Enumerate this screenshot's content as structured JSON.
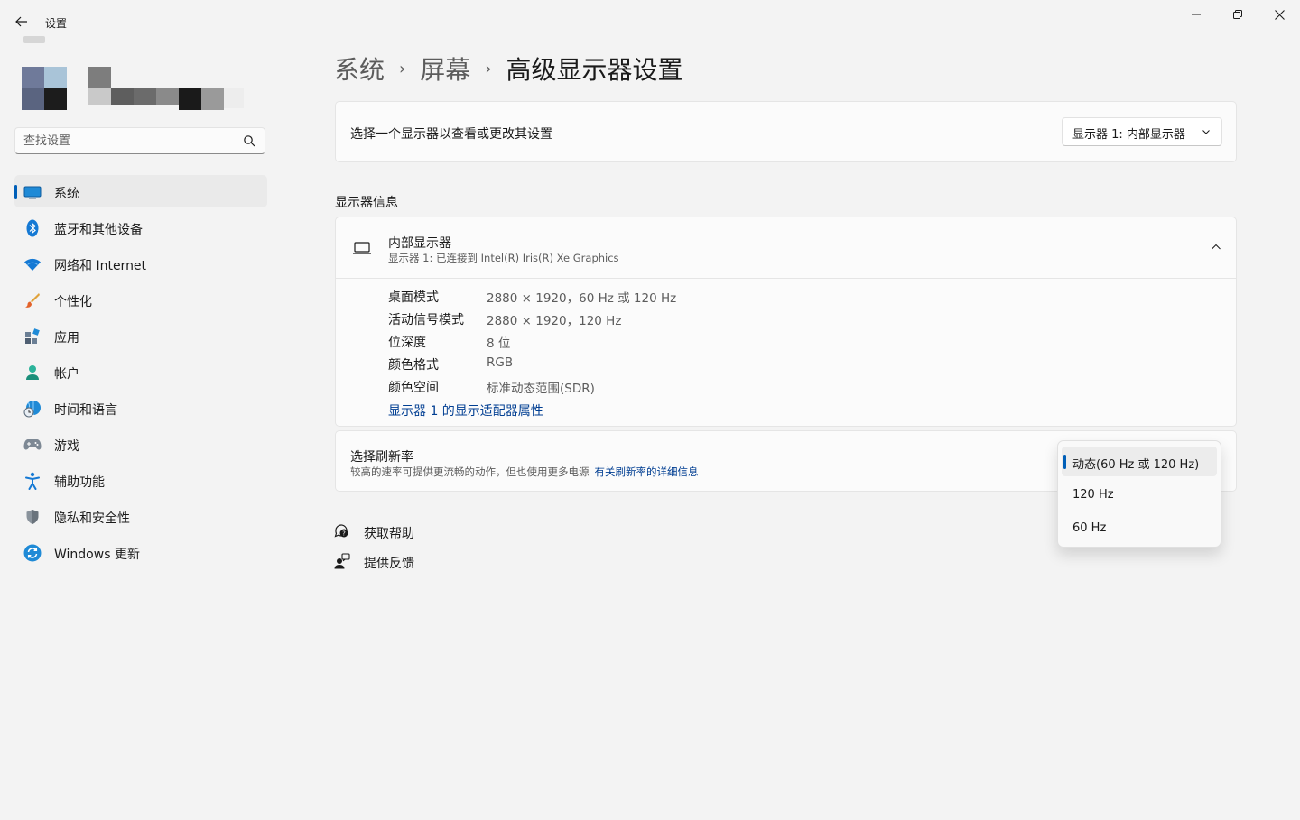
{
  "window": {
    "title": "设置",
    "controls": {
      "minimize": "minimize-icon",
      "restore": "restore-icon",
      "close": "close-icon"
    }
  },
  "search": {
    "placeholder": "查找设置",
    "value": ""
  },
  "sidebar": {
    "items": [
      {
        "label": "系统",
        "icon": "system-display-icon",
        "active": true
      },
      {
        "label": "蓝牙和其他设备",
        "icon": "bluetooth-icon"
      },
      {
        "label": "网络和 Internet",
        "icon": "wifi-icon"
      },
      {
        "label": "个性化",
        "icon": "paintbrush-icon"
      },
      {
        "label": "应用",
        "icon": "apps-icon"
      },
      {
        "label": "帐户",
        "icon": "account-icon"
      },
      {
        "label": "时间和语言",
        "icon": "time-language-icon"
      },
      {
        "label": "游戏",
        "icon": "gamepad-icon"
      },
      {
        "label": "辅助功能",
        "icon": "accessibility-icon"
      },
      {
        "label": "隐私和安全性",
        "icon": "shield-icon"
      },
      {
        "label": "Windows 更新",
        "icon": "windows-update-icon"
      }
    ]
  },
  "breadcrumb": {
    "level1": "系统",
    "level2": "屏幕",
    "current": "高级显示器设置",
    "separator": "›"
  },
  "display_select": {
    "label": "选择一个显示器以查看或更改其设置",
    "selected": "显示器 1: 内部显示器"
  },
  "display_info": {
    "section_title": "显示器信息",
    "name": "内部显示器",
    "subtitle": "显示器 1: 已连接到 Intel(R) Iris(R) Xe Graphics",
    "rows": [
      {
        "key": "桌面模式",
        "value": "2880 × 1920，60 Hz 或 120 Hz"
      },
      {
        "key": "活动信号模式",
        "value": "2880 × 1920，120 Hz"
      },
      {
        "key": "位深度",
        "value": "8 位"
      },
      {
        "key": "颜色格式",
        "value": "RGB"
      },
      {
        "key": "颜色空间",
        "value": "标准动态范围(SDR)"
      }
    ],
    "adapter_link": "显示器 1 的显示适配器属性"
  },
  "refresh_rate": {
    "title": "选择刷新率",
    "description": "较高的速率可提供更流畅的动作，但也使用更多电源",
    "link": "有关刷新率的详细信息",
    "options": [
      "动态(60 Hz 或 120 Hz)",
      "120 Hz",
      "60 Hz"
    ],
    "selected_index": 0
  },
  "help_links": [
    {
      "label": "获取帮助",
      "icon": "help-icon"
    },
    {
      "label": "提供反馈",
      "icon": "feedback-icon"
    }
  ],
  "colors": {
    "accent": "#005fb8",
    "link": "#003e92",
    "background": "#f3f3f3",
    "card": "#fbfbfb"
  }
}
